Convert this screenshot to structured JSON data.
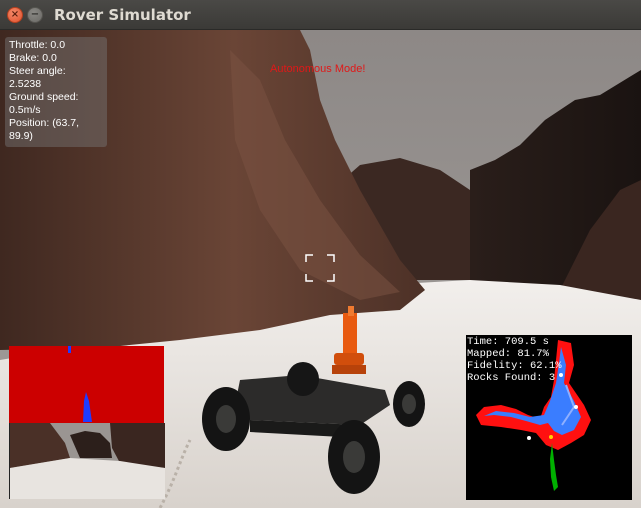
{
  "window": {
    "title": "Rover Simulator",
    "close_glyph": "×",
    "minimize_glyph": "−"
  },
  "telemetry": {
    "throttle": "Throttle: 0.0",
    "brake": "Brake: 0.0",
    "steer_label": "Steer angle:",
    "steer_value": "2.5238",
    "speed_label": "Ground speed:",
    "speed_value": "0.5m/s",
    "position_label": "Position: (63.7,",
    "position_value": "89.9)"
  },
  "mode_text": "Autonomous Mode!",
  "map_stats": {
    "time": "Time: 709.5 s",
    "mapped": "Mapped: 81.7%",
    "fidelity": "Fidelity: 62.1%",
    "rocks": "Rocks Found: 3"
  },
  "colors": {
    "sky": "#8a8583",
    "rock": "#5a3a2c",
    "sand": "#ece8e4",
    "mode_text": "#e01818",
    "threshold_red": "#cc0000",
    "navigable_blue": "#1f3cff",
    "map_red": "#ff1010",
    "map_blue": "#3a7dff",
    "map_green": "#00b000",
    "rover_orange": "#e85a10"
  },
  "icons": {
    "close": "close-icon",
    "minimize": "minimize-icon",
    "reticle": "crosshair-icon"
  }
}
